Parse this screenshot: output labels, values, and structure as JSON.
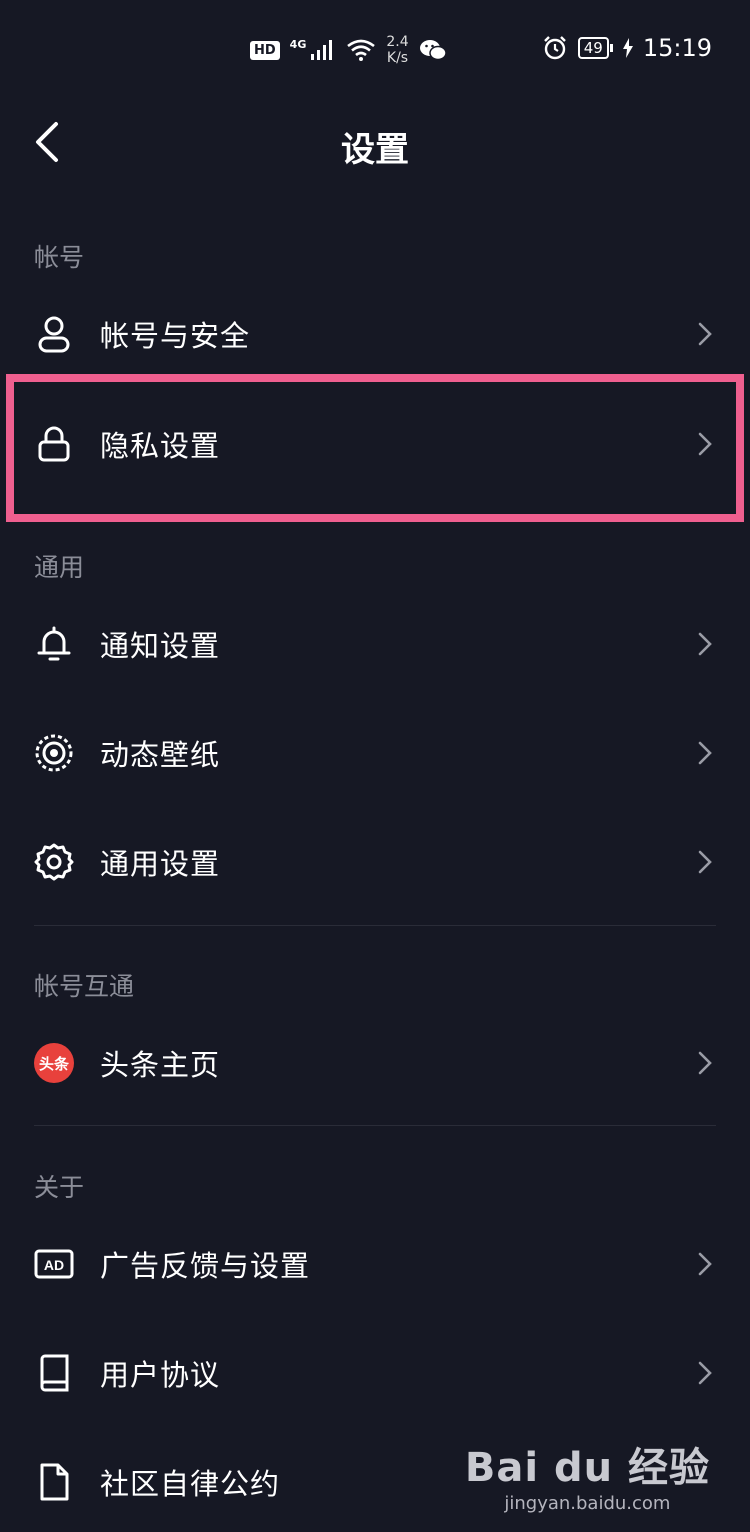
{
  "status_bar": {
    "hd": "HD",
    "network": "4G",
    "speed_value": "2.4",
    "speed_unit": "K/s",
    "battery": "49",
    "time": "15:19"
  },
  "header": {
    "title": "设置"
  },
  "sections": {
    "account": {
      "label": "帐号"
    },
    "general": {
      "label": "通用"
    },
    "linked": {
      "label": "帐号互通"
    },
    "about": {
      "label": "关于"
    }
  },
  "items": {
    "account_security": "帐号与安全",
    "privacy_settings": "隐私设置",
    "notification_settings": "通知设置",
    "live_wallpaper": "动态壁纸",
    "general_settings": "通用设置",
    "toutiao_home": "头条主页",
    "toutiao_badge": "头条",
    "ad_feedback": "广告反馈与设置",
    "ad_icon_text": "AD",
    "user_agreement": "用户协议",
    "community_guidelines": "社区自律公约"
  },
  "colors": {
    "background": "#161824",
    "highlight": "#ef5f8f",
    "section_label": "#8b8d98"
  },
  "watermark": {
    "logo": "Bai du 经验",
    "url": "jingyan.baidu.com"
  }
}
